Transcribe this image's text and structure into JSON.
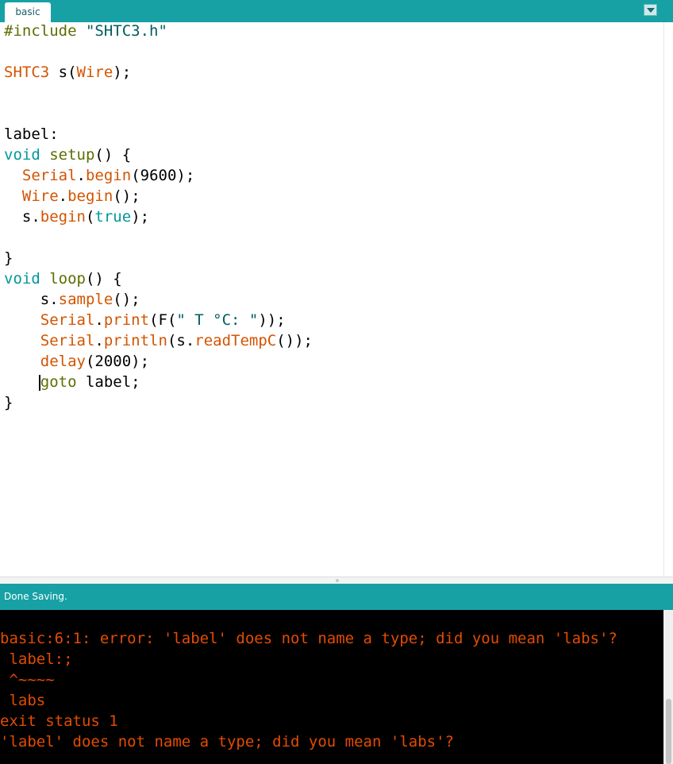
{
  "tabs": {
    "active_label": "basic"
  },
  "code_lines": [
    {
      "tokens": [
        {
          "cls": "t-pp",
          "text": "#include "
        },
        {
          "cls": "t-str",
          "text": "\"SHTC3.h\""
        }
      ]
    },
    {
      "tokens": []
    },
    {
      "tokens": [
        {
          "cls": "t-cls",
          "text": "SHTC3"
        },
        {
          "cls": "t-pl",
          "text": " s("
        },
        {
          "cls": "t-cls",
          "text": "Wire"
        },
        {
          "cls": "t-pl",
          "text": ");"
        }
      ]
    },
    {
      "tokens": []
    },
    {
      "tokens": []
    },
    {
      "tokens": [
        {
          "cls": "t-pl",
          "text": "label:"
        }
      ]
    },
    {
      "tokens": [
        {
          "cls": "t-ty",
          "text": "void"
        },
        {
          "cls": "t-pl",
          "text": " "
        },
        {
          "cls": "t-def",
          "text": "setup"
        },
        {
          "cls": "t-pl",
          "text": "() {"
        }
      ]
    },
    {
      "tokens": [
        {
          "cls": "t-pl",
          "text": "  "
        },
        {
          "cls": "t-cls",
          "text": "Serial"
        },
        {
          "cls": "t-pl",
          "text": "."
        },
        {
          "cls": "t-fn",
          "text": "begin"
        },
        {
          "cls": "t-pl",
          "text": "(9600);"
        }
      ]
    },
    {
      "tokens": [
        {
          "cls": "t-pl",
          "text": "  "
        },
        {
          "cls": "t-cls",
          "text": "Wire"
        },
        {
          "cls": "t-pl",
          "text": "."
        },
        {
          "cls": "t-fn",
          "text": "begin"
        },
        {
          "cls": "t-pl",
          "text": "();"
        }
      ]
    },
    {
      "tokens": [
        {
          "cls": "t-pl",
          "text": "  s."
        },
        {
          "cls": "t-fn",
          "text": "begin"
        },
        {
          "cls": "t-pl",
          "text": "("
        },
        {
          "cls": "t-kw",
          "text": "true"
        },
        {
          "cls": "t-pl",
          "text": ");"
        }
      ]
    },
    {
      "tokens": []
    },
    {
      "tokens": [
        {
          "cls": "t-pl",
          "text": "}"
        }
      ]
    },
    {
      "tokens": [
        {
          "cls": "t-ty",
          "text": "void"
        },
        {
          "cls": "t-pl",
          "text": " "
        },
        {
          "cls": "t-def",
          "text": "loop"
        },
        {
          "cls": "t-pl",
          "text": "() {"
        }
      ]
    },
    {
      "tokens": [
        {
          "cls": "t-pl",
          "text": "    s."
        },
        {
          "cls": "t-fn",
          "text": "sample"
        },
        {
          "cls": "t-pl",
          "text": "();"
        }
      ]
    },
    {
      "tokens": [
        {
          "cls": "t-pl",
          "text": "    "
        },
        {
          "cls": "t-cls",
          "text": "Serial"
        },
        {
          "cls": "t-pl",
          "text": "."
        },
        {
          "cls": "t-fn",
          "text": "print"
        },
        {
          "cls": "t-pl",
          "text": "(F("
        },
        {
          "cls": "t-str",
          "text": "\" T °C: \""
        },
        {
          "cls": "t-pl",
          "text": "));"
        }
      ]
    },
    {
      "tokens": [
        {
          "cls": "t-pl",
          "text": "    "
        },
        {
          "cls": "t-cls",
          "text": "Serial"
        },
        {
          "cls": "t-pl",
          "text": "."
        },
        {
          "cls": "t-fn",
          "text": "println"
        },
        {
          "cls": "t-pl",
          "text": "(s."
        },
        {
          "cls": "t-fn",
          "text": "readTempC"
        },
        {
          "cls": "t-pl",
          "text": "());"
        }
      ]
    },
    {
      "tokens": [
        {
          "cls": "t-pl",
          "text": "    "
        },
        {
          "cls": "t-fn",
          "text": "delay"
        },
        {
          "cls": "t-pl",
          "text": "(2000);"
        }
      ]
    },
    {
      "tokens": [
        {
          "cls": "t-pl",
          "text": "    "
        },
        {
          "cls": "t-pp",
          "text": "goto"
        },
        {
          "cls": "t-pl",
          "text": " label;"
        }
      ]
    },
    {
      "tokens": [
        {
          "cls": "t-pl",
          "text": "}"
        }
      ]
    }
  ],
  "status": {
    "message": "Done Saving."
  },
  "console_lines": [
    "basic:6:1: error: 'label' does not name a type; did you mean 'labs'?",
    " label:;",
    " ^~~~~",
    " labs",
    "exit status 1",
    "'label' does not name a type; did you mean 'labs'?"
  ],
  "colors": {
    "toolbar_teal": "#17a1a5",
    "error_orange": "#e34c00",
    "console_bg": "#000000"
  }
}
